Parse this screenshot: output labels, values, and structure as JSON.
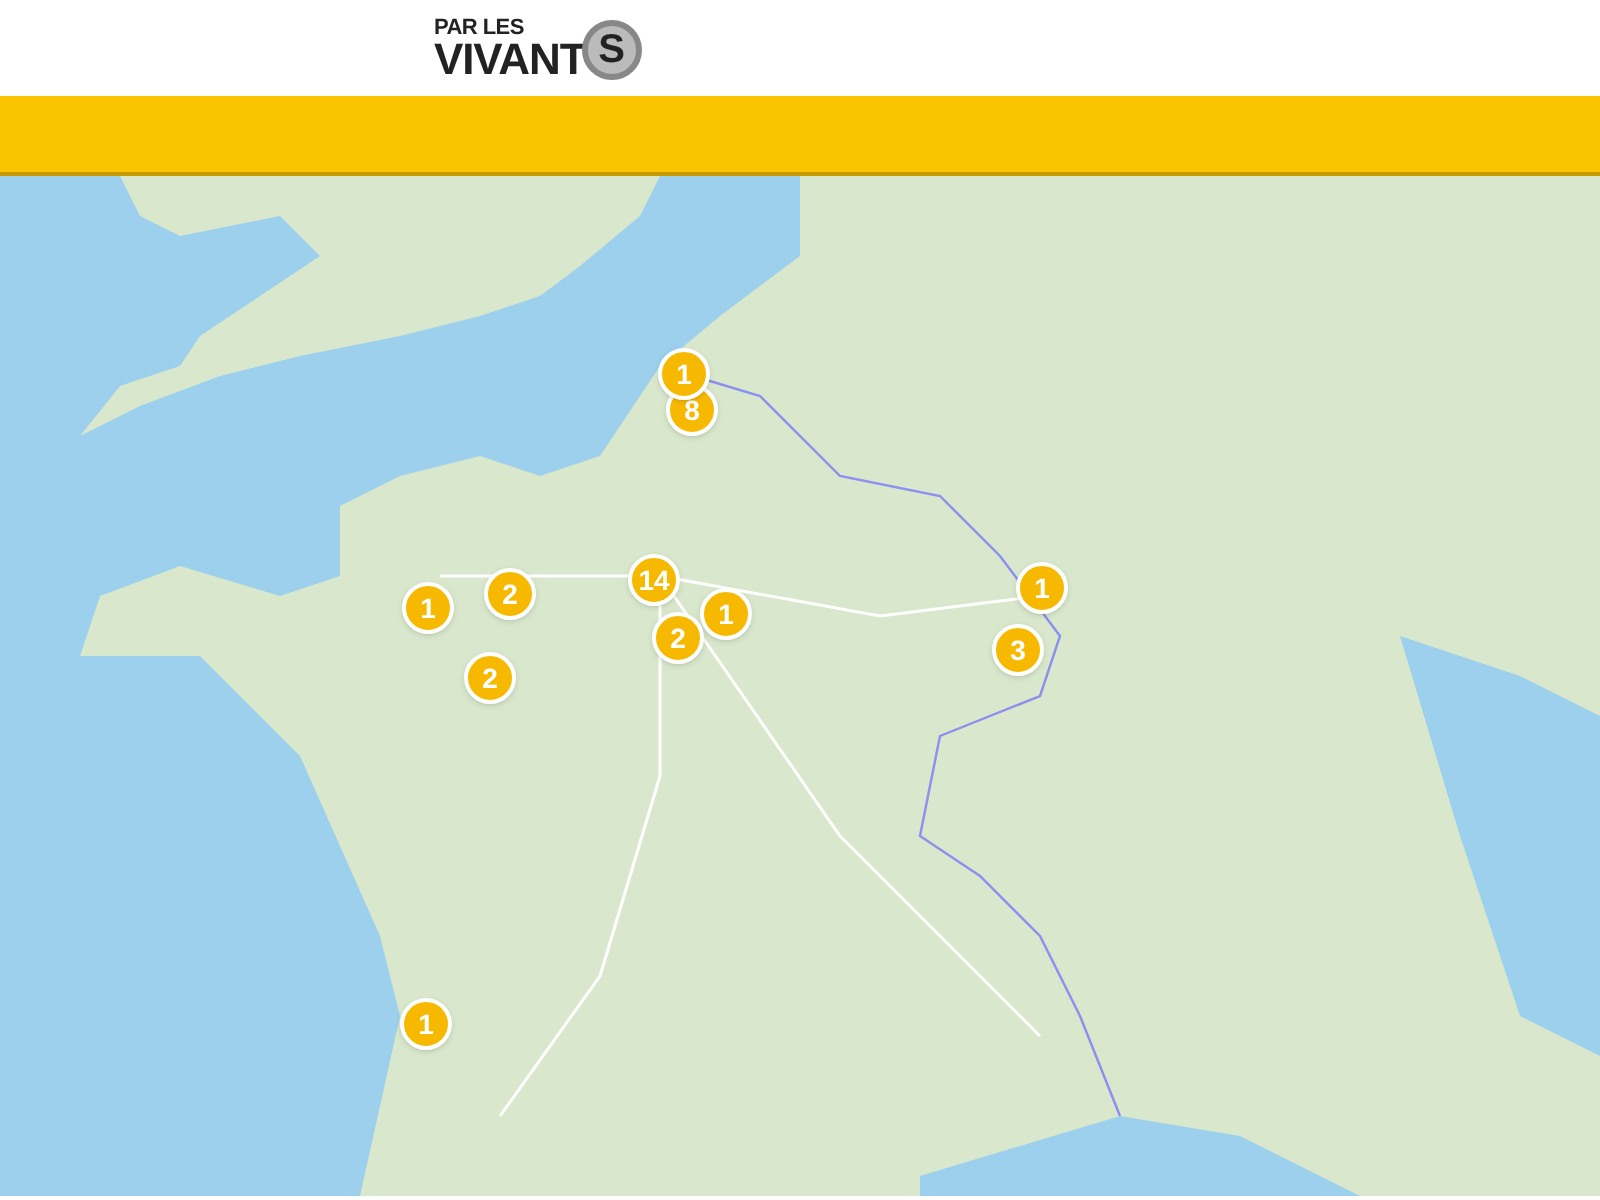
{
  "logo": {
    "line_1": "PAR LES",
    "line_2": "VIVANT",
    "mark": "S"
  },
  "map": {
    "clusters": [
      {
        "count": "8"
      },
      {
        "count": "1"
      },
      {
        "count": "1"
      },
      {
        "count": "2"
      },
      {
        "count": "2"
      },
      {
        "count": "14"
      },
      {
        "count": "1"
      },
      {
        "count": "2"
      },
      {
        "count": "1"
      },
      {
        "count": "3"
      },
      {
        "count": "1"
      }
    ]
  }
}
